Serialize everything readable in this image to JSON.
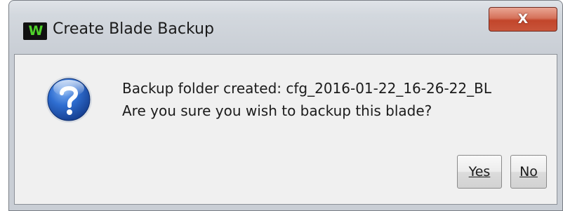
{
  "window": {
    "title": "Create Blade Backup",
    "close_label": "X"
  },
  "icons": {
    "app_logo": "W",
    "app_logo_color": "#4fd12b",
    "dialog_icon": "question-icon"
  },
  "dialog": {
    "message_line1": "Backup folder created: cfg_2016-01-22_16-26-22_BL",
    "message_line2": "Are you sure you wish to backup this blade?"
  },
  "buttons": {
    "yes_label": "Yes",
    "no_label": "No"
  }
}
